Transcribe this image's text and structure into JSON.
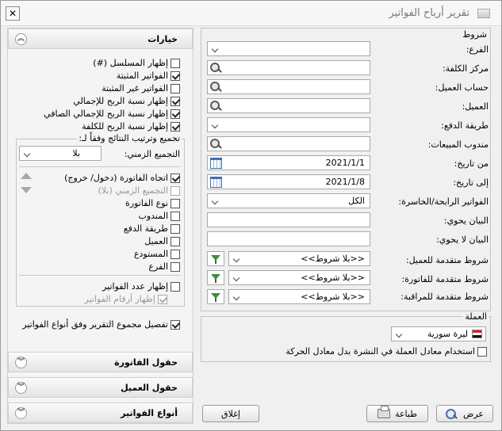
{
  "window": {
    "title": "تقرير أرباح الفواتير",
    "close_label": "✕"
  },
  "options": {
    "header": "خيارات",
    "checks": [
      {
        "label": "إظهار المسلسل (#)",
        "checked": false
      },
      {
        "label": "الفواتير المثبتة",
        "checked": true
      },
      {
        "label": "الفواتير غير المثبتة",
        "checked": false
      },
      {
        "label": "إظهار نسبة الربح للإجمالي",
        "checked": true
      },
      {
        "label": "إظهار نسبة الربح للإجمالي الصافي",
        "checked": true
      },
      {
        "label": "إظهار نسبة الربح للكلفة",
        "checked": true
      }
    ],
    "grouping": {
      "title": "تجميع وترتيب النتائج وفقاً لـ:",
      "time_label": "التجميع الزمني:",
      "time_value": "بلا",
      "items": [
        {
          "label": "اتجاه الفاتورة (دخول/ خروج)",
          "checked": true,
          "disabled": false
        },
        {
          "label": "التجميع الزمني (بلا)",
          "checked": false,
          "disabled": true
        },
        {
          "label": "نوع الفاتورة",
          "checked": false,
          "disabled": false
        },
        {
          "label": "المندوب",
          "checked": false,
          "disabled": false
        },
        {
          "label": "طريقة الدفع",
          "checked": false,
          "disabled": false
        },
        {
          "label": "العميل",
          "checked": false,
          "disabled": false
        },
        {
          "label": "المستودع",
          "checked": false,
          "disabled": false
        },
        {
          "label": "الفرع",
          "checked": false,
          "disabled": false
        }
      ],
      "show_count": {
        "label": "إظهار عدد الفواتير",
        "checked": false
      },
      "show_numbers": {
        "label": "إظهار أرقام الفواتير",
        "checked": true,
        "disabled": true
      }
    },
    "detail": {
      "label": "تفصيل مجموع التقرير وفق أنواع الفواتير",
      "checked": true
    }
  },
  "sections": [
    {
      "label": "حقول الفاتورة"
    },
    {
      "label": "حقول العميل"
    },
    {
      "label": "أنواع الفواتير"
    }
  ],
  "conditions": {
    "title": "شروط",
    "fields": [
      {
        "label": "الفرع:",
        "value": ""
      },
      {
        "label": "مركز الكلفة:",
        "value": ""
      },
      {
        "label": "حساب العميل:",
        "value": ""
      },
      {
        "label": "العميل:",
        "value": ""
      },
      {
        "label": "طريقة الدفع:",
        "value": ""
      },
      {
        "label": "مندوب المبيعات:",
        "value": ""
      },
      {
        "label": "من تاريخ:",
        "value": "2021/1/1"
      },
      {
        "label": "إلى تاريخ:",
        "value": "2021/1/8"
      },
      {
        "label": "الفواتير الرابحة/الخاسرة:",
        "value": "الكل"
      },
      {
        "label": "البيان يحوي:",
        "value": ""
      },
      {
        "label": "البيان لا يحوي:",
        "value": ""
      },
      {
        "label": "شروط متقدمة للعميل:",
        "value": "<<بلا شروط>>"
      },
      {
        "label": "شروط متقدمة للفاتورة:",
        "value": "<<بلا شروط>>"
      },
      {
        "label": "شروط متقدمة للمراقبة:",
        "value": "<<بلا شروط>>"
      }
    ]
  },
  "currency": {
    "title": "العملة",
    "value": "ليرة سورية",
    "use_rate": {
      "label": "استخدام معادل العملة في النشرة بدل معادل الحركة",
      "checked": false
    }
  },
  "buttons": {
    "close": "إغلاق",
    "print": "طباعة",
    "view": "عرض"
  }
}
